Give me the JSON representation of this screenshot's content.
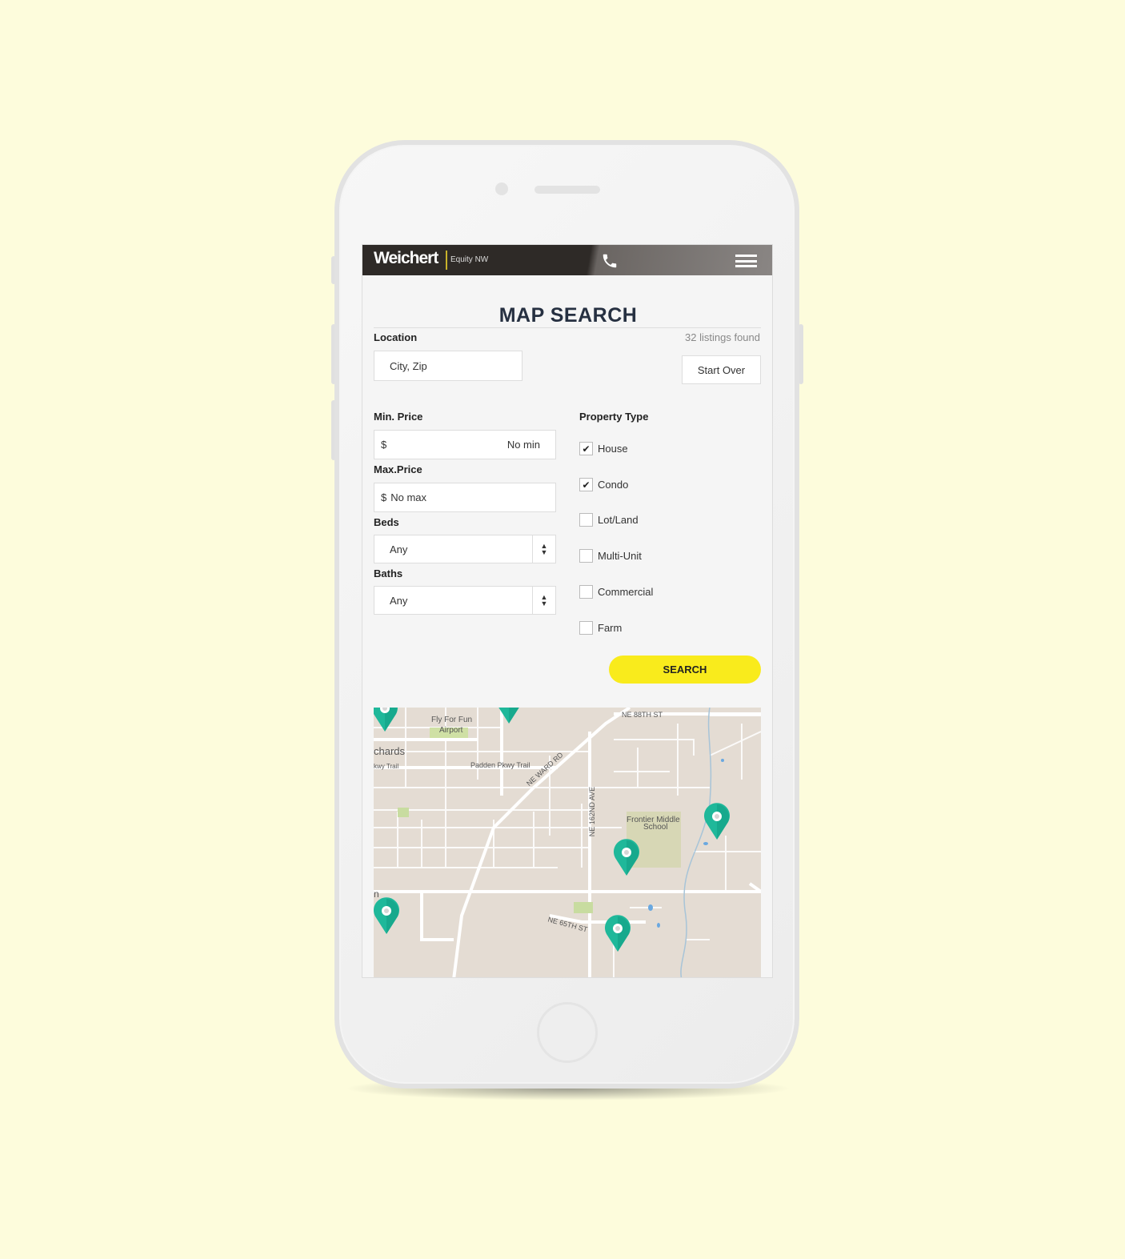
{
  "header": {
    "logo": "Weichert",
    "logo_sub": "Equity NW",
    "phone_icon": "phone-icon",
    "menu_icon": "hamburger-menu-icon"
  },
  "page": {
    "title": "MAP SEARCH",
    "listings_found": "32 listings found",
    "start_over": "Start Over"
  },
  "location": {
    "label": "Location",
    "placeholder": "City, Zip"
  },
  "min_price": {
    "label": "Min. Price",
    "prefix": "$",
    "placeholder": "No min"
  },
  "max_price": {
    "label": "Max.Price",
    "prefix": "$",
    "placeholder": "No max"
  },
  "beds": {
    "label": "Beds",
    "value": "Any"
  },
  "baths": {
    "label": "Baths",
    "value": "Any"
  },
  "property_type": {
    "label": "Property Type",
    "options": [
      {
        "label": "House",
        "checked": true
      },
      {
        "label": "Condo",
        "checked": true
      },
      {
        "label": "Lot/Land",
        "checked": false
      },
      {
        "label": "Multi-Unit",
        "checked": false
      },
      {
        "label": "Commercial",
        "checked": false
      },
      {
        "label": "Farm",
        "checked": false
      }
    ]
  },
  "search_button": "SEARCH",
  "map": {
    "labels": [
      "Fly For Fun",
      "Airport",
      "chards",
      "kwy Trail",
      "Padden Pkwy Trail",
      "NE WARD RD",
      "NE 88TH ST",
      "NE 162ND AVE",
      "Frontier Middle",
      "School",
      "NE 65TH ST",
      "n"
    ],
    "pin_color": "#1fb89a",
    "pin_count": 6
  }
}
